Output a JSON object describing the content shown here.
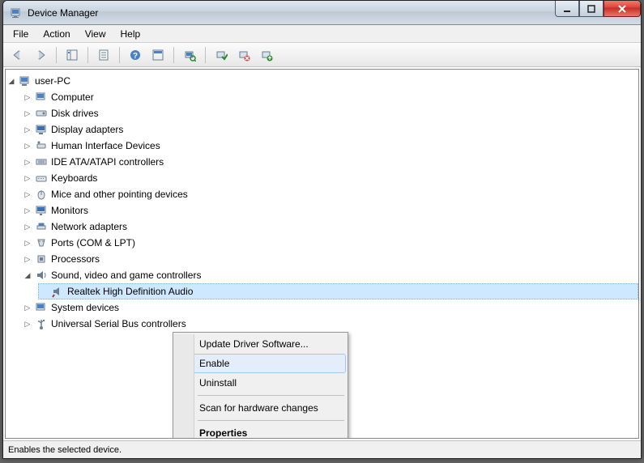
{
  "window": {
    "title": "Device Manager"
  },
  "menubar": {
    "file": "File",
    "action": "Action",
    "view": "View",
    "help": "Help"
  },
  "tree": {
    "root": "user-PC",
    "items": {
      "computer": "Computer",
      "disk": "Disk drives",
      "display": "Display adapters",
      "hid": "Human Interface Devices",
      "ide": "IDE ATA/ATAPI controllers",
      "keyboards": "Keyboards",
      "mice": "Mice and other pointing devices",
      "monitors": "Monitors",
      "network": "Network adapters",
      "ports": "Ports (COM & LPT)",
      "processors": "Processors",
      "sound": "Sound, video and game controllers",
      "sound_child": "Realtek High Definition Audio",
      "system": "System devices",
      "usb": "Universal Serial Bus controllers"
    }
  },
  "context_menu": {
    "update": "Update Driver Software...",
    "enable": "Enable",
    "uninstall": "Uninstall",
    "scan": "Scan for hardware changes",
    "properties": "Properties"
  },
  "status": "Enables the selected device."
}
